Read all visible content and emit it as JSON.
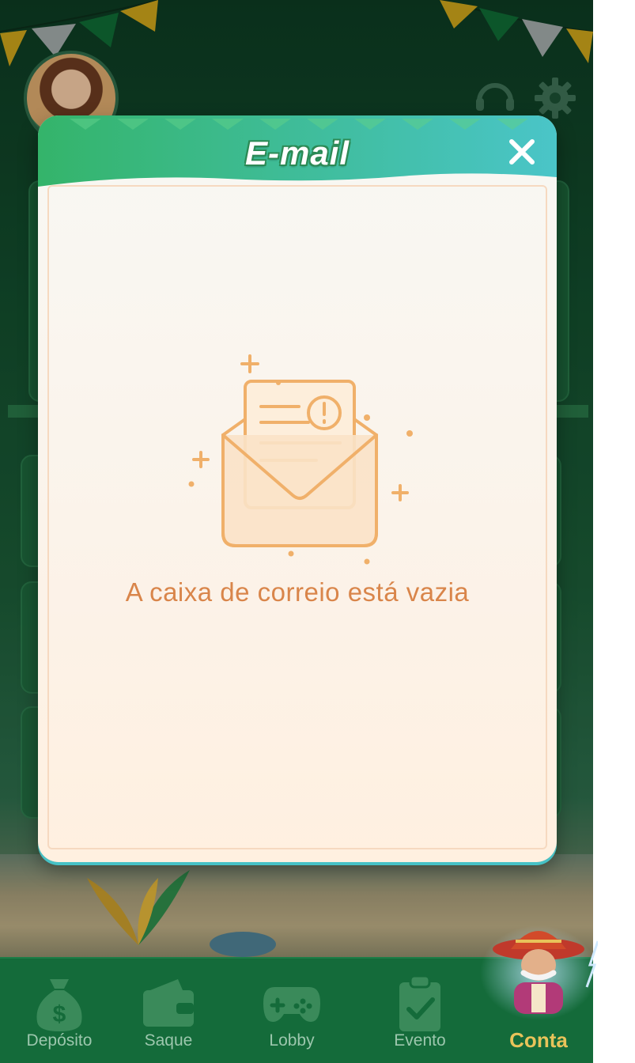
{
  "modal": {
    "title": "E-mail",
    "empty_message": "A caixa de correio está vazia"
  },
  "bottom_nav": {
    "items": [
      {
        "label": "Depósito",
        "icon": "money-bag-icon"
      },
      {
        "label": "Saque",
        "icon": "wallet-icon"
      },
      {
        "label": "Lobby",
        "icon": "gamepad-icon"
      },
      {
        "label": "Evento",
        "icon": "clipboard-check-icon"
      },
      {
        "label": "Conta",
        "icon": "mascot-icon",
        "active": true
      }
    ]
  },
  "colors": {
    "header_green": "#33b96b",
    "header_teal": "#47c3c7",
    "accent_orange": "#d9854a",
    "nav_bg": "#146b3a",
    "nav_active": "#e8c35a"
  }
}
